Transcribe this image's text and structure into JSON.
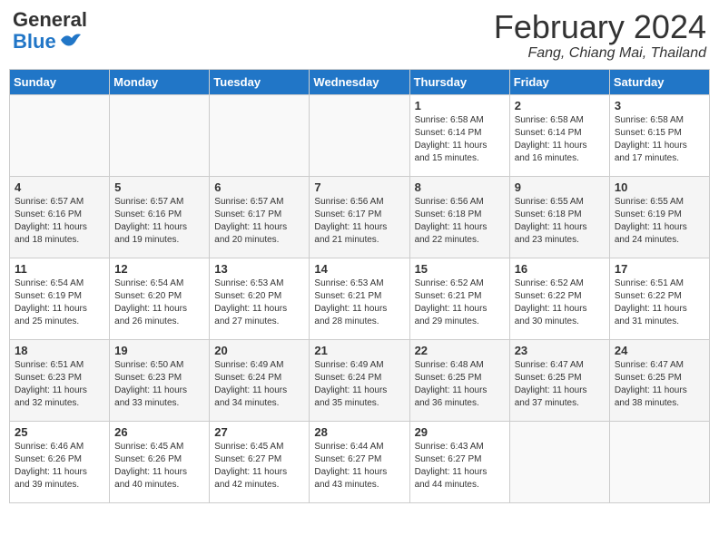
{
  "header": {
    "logo_general": "General",
    "logo_blue": "Blue",
    "month_year": "February 2024",
    "location": "Fang, Chiang Mai, Thailand"
  },
  "weekdays": [
    "Sunday",
    "Monday",
    "Tuesday",
    "Wednesday",
    "Thursday",
    "Friday",
    "Saturday"
  ],
  "weeks": [
    [
      {
        "day": "",
        "sunrise": "",
        "sunset": "",
        "daylight": ""
      },
      {
        "day": "",
        "sunrise": "",
        "sunset": "",
        "daylight": ""
      },
      {
        "day": "",
        "sunrise": "",
        "sunset": "",
        "daylight": ""
      },
      {
        "day": "",
        "sunrise": "",
        "sunset": "",
        "daylight": ""
      },
      {
        "day": "1",
        "sunrise": "Sunrise: 6:58 AM",
        "sunset": "Sunset: 6:14 PM",
        "daylight": "Daylight: 11 hours and 15 minutes."
      },
      {
        "day": "2",
        "sunrise": "Sunrise: 6:58 AM",
        "sunset": "Sunset: 6:14 PM",
        "daylight": "Daylight: 11 hours and 16 minutes."
      },
      {
        "day": "3",
        "sunrise": "Sunrise: 6:58 AM",
        "sunset": "Sunset: 6:15 PM",
        "daylight": "Daylight: 11 hours and 17 minutes."
      }
    ],
    [
      {
        "day": "4",
        "sunrise": "Sunrise: 6:57 AM",
        "sunset": "Sunset: 6:16 PM",
        "daylight": "Daylight: 11 hours and 18 minutes."
      },
      {
        "day": "5",
        "sunrise": "Sunrise: 6:57 AM",
        "sunset": "Sunset: 6:16 PM",
        "daylight": "Daylight: 11 hours and 19 minutes."
      },
      {
        "day": "6",
        "sunrise": "Sunrise: 6:57 AM",
        "sunset": "Sunset: 6:17 PM",
        "daylight": "Daylight: 11 hours and 20 minutes."
      },
      {
        "day": "7",
        "sunrise": "Sunrise: 6:56 AM",
        "sunset": "Sunset: 6:17 PM",
        "daylight": "Daylight: 11 hours and 21 minutes."
      },
      {
        "day": "8",
        "sunrise": "Sunrise: 6:56 AM",
        "sunset": "Sunset: 6:18 PM",
        "daylight": "Daylight: 11 hours and 22 minutes."
      },
      {
        "day": "9",
        "sunrise": "Sunrise: 6:55 AM",
        "sunset": "Sunset: 6:18 PM",
        "daylight": "Daylight: 11 hours and 23 minutes."
      },
      {
        "day": "10",
        "sunrise": "Sunrise: 6:55 AM",
        "sunset": "Sunset: 6:19 PM",
        "daylight": "Daylight: 11 hours and 24 minutes."
      }
    ],
    [
      {
        "day": "11",
        "sunrise": "Sunrise: 6:54 AM",
        "sunset": "Sunset: 6:19 PM",
        "daylight": "Daylight: 11 hours and 25 minutes."
      },
      {
        "day": "12",
        "sunrise": "Sunrise: 6:54 AM",
        "sunset": "Sunset: 6:20 PM",
        "daylight": "Daylight: 11 hours and 26 minutes."
      },
      {
        "day": "13",
        "sunrise": "Sunrise: 6:53 AM",
        "sunset": "Sunset: 6:20 PM",
        "daylight": "Daylight: 11 hours and 27 minutes."
      },
      {
        "day": "14",
        "sunrise": "Sunrise: 6:53 AM",
        "sunset": "Sunset: 6:21 PM",
        "daylight": "Daylight: 11 hours and 28 minutes."
      },
      {
        "day": "15",
        "sunrise": "Sunrise: 6:52 AM",
        "sunset": "Sunset: 6:21 PM",
        "daylight": "Daylight: 11 hours and 29 minutes."
      },
      {
        "day": "16",
        "sunrise": "Sunrise: 6:52 AM",
        "sunset": "Sunset: 6:22 PM",
        "daylight": "Daylight: 11 hours and 30 minutes."
      },
      {
        "day": "17",
        "sunrise": "Sunrise: 6:51 AM",
        "sunset": "Sunset: 6:22 PM",
        "daylight": "Daylight: 11 hours and 31 minutes."
      }
    ],
    [
      {
        "day": "18",
        "sunrise": "Sunrise: 6:51 AM",
        "sunset": "Sunset: 6:23 PM",
        "daylight": "Daylight: 11 hours and 32 minutes."
      },
      {
        "day": "19",
        "sunrise": "Sunrise: 6:50 AM",
        "sunset": "Sunset: 6:23 PM",
        "daylight": "Daylight: 11 hours and 33 minutes."
      },
      {
        "day": "20",
        "sunrise": "Sunrise: 6:49 AM",
        "sunset": "Sunset: 6:24 PM",
        "daylight": "Daylight: 11 hours and 34 minutes."
      },
      {
        "day": "21",
        "sunrise": "Sunrise: 6:49 AM",
        "sunset": "Sunset: 6:24 PM",
        "daylight": "Daylight: 11 hours and 35 minutes."
      },
      {
        "day": "22",
        "sunrise": "Sunrise: 6:48 AM",
        "sunset": "Sunset: 6:25 PM",
        "daylight": "Daylight: 11 hours and 36 minutes."
      },
      {
        "day": "23",
        "sunrise": "Sunrise: 6:47 AM",
        "sunset": "Sunset: 6:25 PM",
        "daylight": "Daylight: 11 hours and 37 minutes."
      },
      {
        "day": "24",
        "sunrise": "Sunrise: 6:47 AM",
        "sunset": "Sunset: 6:25 PM",
        "daylight": "Daylight: 11 hours and 38 minutes."
      }
    ],
    [
      {
        "day": "25",
        "sunrise": "Sunrise: 6:46 AM",
        "sunset": "Sunset: 6:26 PM",
        "daylight": "Daylight: 11 hours and 39 minutes."
      },
      {
        "day": "26",
        "sunrise": "Sunrise: 6:45 AM",
        "sunset": "Sunset: 6:26 PM",
        "daylight": "Daylight: 11 hours and 40 minutes."
      },
      {
        "day": "27",
        "sunrise": "Sunrise: 6:45 AM",
        "sunset": "Sunset: 6:27 PM",
        "daylight": "Daylight: 11 hours and 42 minutes."
      },
      {
        "day": "28",
        "sunrise": "Sunrise: 6:44 AM",
        "sunset": "Sunset: 6:27 PM",
        "daylight": "Daylight: 11 hours and 43 minutes."
      },
      {
        "day": "29",
        "sunrise": "Sunrise: 6:43 AM",
        "sunset": "Sunset: 6:27 PM",
        "daylight": "Daylight: 11 hours and 44 minutes."
      },
      {
        "day": "",
        "sunrise": "",
        "sunset": "",
        "daylight": ""
      },
      {
        "day": "",
        "sunrise": "",
        "sunset": "",
        "daylight": ""
      }
    ]
  ]
}
